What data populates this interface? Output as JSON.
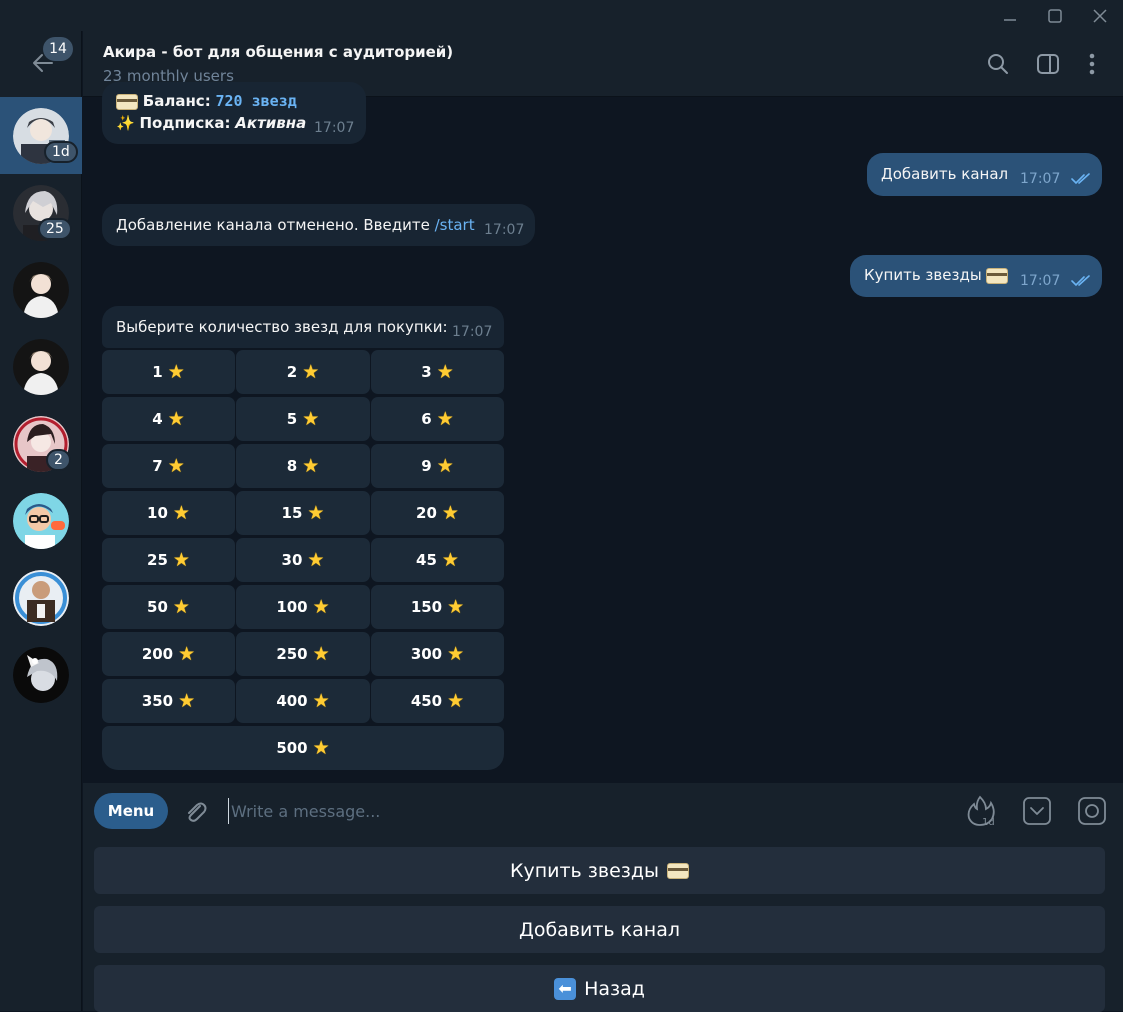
{
  "header": {
    "title": "Акира - бот для общения с аудиторией)",
    "subtitle": "23 monthly users"
  },
  "sidebar": {
    "back_badge": "14",
    "chats": [
      {
        "badge": "1d"
      },
      {
        "badge": "25"
      },
      {
        "badge": ""
      },
      {
        "badge": ""
      },
      {
        "badge": "2"
      },
      {
        "badge": ""
      },
      {
        "badge": ""
      },
      {
        "badge": ""
      }
    ]
  },
  "messages": {
    "m1_line1_label": "Баланс:",
    "m1_line1_value": "720 звезд",
    "m1_line2_label": "Подписка:",
    "m1_line2_value": "Активна",
    "m1_time": "17:07",
    "m2_text": "Добавить канал",
    "m2_time": "17:07",
    "m3_text": "Добавление канала отменено. Введите",
    "m3_link": "/start",
    "m3_time": "17:07",
    "m4_text": "Купить звезды",
    "m4_time": "17:07",
    "m5_text": "Выберите количество звезд для покупки:",
    "m5_time": "17:07"
  },
  "keyboard": [
    "1",
    "2",
    "3",
    "4",
    "5",
    "6",
    "7",
    "8",
    "9",
    "10",
    "15",
    "20",
    "25",
    "30",
    "45",
    "50",
    "100",
    "150",
    "200",
    "250",
    "300",
    "350",
    "400",
    "450",
    "500"
  ],
  "input": {
    "menu_label": "Menu",
    "placeholder": "Write a message..."
  },
  "reply_keyboard": {
    "buy_label": "Купить звезды",
    "add_label": "Добавить канал",
    "back_label": "Назад"
  },
  "colors": {
    "background": "#0e1621",
    "panel": "#17212b",
    "outgoing": "#2b5278",
    "incoming": "#182533",
    "accent": "#6ab3f3"
  }
}
